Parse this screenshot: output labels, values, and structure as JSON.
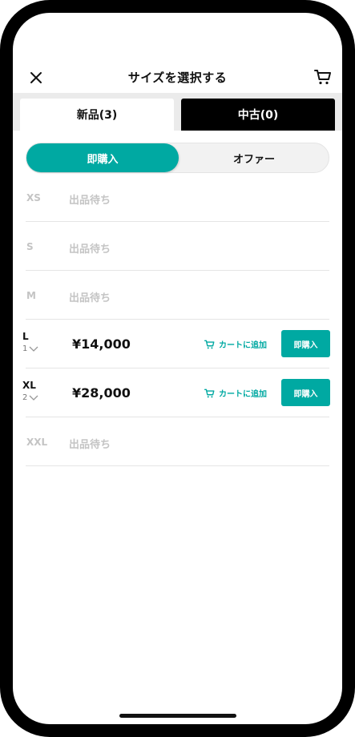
{
  "header": {
    "title": "サイズを選択する"
  },
  "tabs": [
    {
      "label": "新品(3)",
      "active": true
    },
    {
      "label": "中古(0)",
      "active": false
    }
  ],
  "segment": {
    "buy_label": "即購入",
    "offer_label": "オファー"
  },
  "sizes": [
    {
      "size": "XS",
      "status": "出品待ち"
    },
    {
      "size": "S",
      "status": "出品待ち"
    },
    {
      "size": "M",
      "status": "出品待ち"
    },
    {
      "size": "L",
      "qty": "1",
      "price": "¥14,000",
      "cart_label": "カートに追加",
      "buy_label": "即購入"
    },
    {
      "size": "XL",
      "qty": "2",
      "price": "¥28,000",
      "cart_label": "カートに追加",
      "buy_label": "即購入"
    },
    {
      "size": "XXL",
      "status": "出品待ち"
    }
  ],
  "colors": {
    "accent": "#00a9a2",
    "muted_text": "#c4c4c4"
  }
}
